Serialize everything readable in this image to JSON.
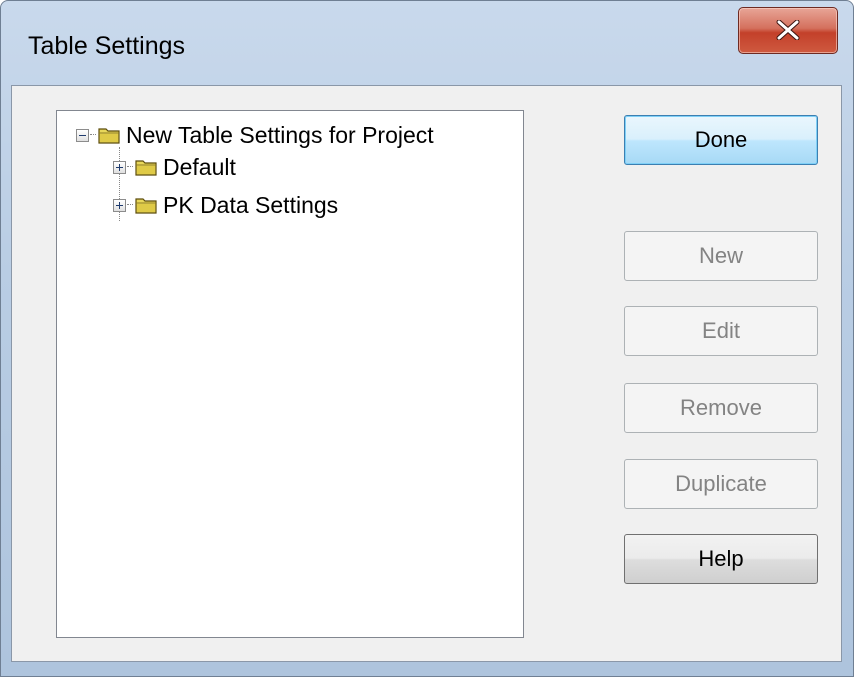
{
  "window": {
    "title": "Table Settings"
  },
  "tree": {
    "root": {
      "label": "New Table Settings for Project"
    },
    "children": [
      {
        "label": "Default"
      },
      {
        "label": "PK Data Settings"
      }
    ]
  },
  "buttons": {
    "done": "Done",
    "new": "New",
    "edit": "Edit",
    "remove": "Remove",
    "duplicate": "Duplicate",
    "help": "Help"
  },
  "icons": {
    "close": "close-icon",
    "folder": "folder-icon",
    "collapse": "minus-expander-icon",
    "expand": "plus-expander-icon"
  },
  "colors": {
    "folder": "#e8d75a",
    "close_button": "#c9432c",
    "disabled_text": "#838383"
  }
}
